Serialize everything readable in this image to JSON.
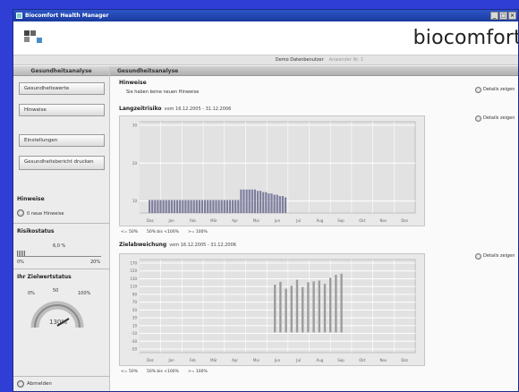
{
  "window": {
    "title": "Biocomfort Health Manager"
  },
  "brand": {
    "name": "biocomfort"
  },
  "userbar": {
    "user": "Demo Datenbenutzer",
    "secondary": "Anwender Nr. 1"
  },
  "sidebar": {
    "tab": "Gesundheitsanalyse",
    "buttons": [
      "Gesundheitswerte",
      "Hinweise",
      "Einstellungen",
      "Gesundheitsbericht drucken"
    ],
    "hinweise_heading": "Hinweise",
    "hinweise_new": "0 neue Hinweise",
    "risiko_heading": "Risikostatus",
    "risiko_value": "6,0 %",
    "risiko_min": "0%",
    "risiko_max": "20%",
    "ziel_heading": "Ihr Zielwertstatus",
    "gauge_min": "0%",
    "gauge_mid": "50",
    "gauge_max": "100%",
    "gauge_value": "130%",
    "logout": "Abmelden"
  },
  "main": {
    "tab": "Gesundheitsanalyse",
    "hinweise_title": "Hinweise",
    "hinweise_text": "Sie haben keine neuen Hinweise",
    "detail_label": "Details zeigen",
    "chart1_title": "Langzeitrisiko",
    "chart1_range": "vom 16.12.2005 - 31.12.2006",
    "chart2_title": "Zielabweichung",
    "chart2_range": "vom 16.12.2005 - 31.12.2006",
    "legend": [
      "<= 50%",
      "50% bis <100%",
      ">= 100%"
    ]
  },
  "chart_data": [
    {
      "type": "bar",
      "title": "Langzeitrisiko",
      "categories": [
        "Dez",
        "Jan",
        "Feb",
        "Mär",
        "Apr",
        "Mai",
        "Jun",
        "Jul",
        "Aug",
        "Sep",
        "Okt",
        "Nov",
        "Dez"
      ],
      "yticks": [
        "30",
        "20",
        "10"
      ],
      "ylim": [
        0,
        35
      ],
      "values": [
        5,
        5,
        5,
        5,
        5,
        5,
        5,
        5,
        5,
        5,
        5,
        5,
        5,
        5,
        5,
        5,
        5,
        5,
        5,
        5,
        5,
        5,
        5,
        5,
        5,
        5,
        5,
        5,
        5,
        5,
        5,
        5,
        5,
        9,
        9,
        9,
        9,
        9,
        9,
        8.5,
        8.5,
        8,
        8,
        7.5,
        7.5,
        7,
        7,
        6.5,
        6.5,
        6
      ],
      "colors": {
        "bar": "#7e7e9e",
        "grid": "#ffffff"
      }
    },
    {
      "type": "bar",
      "title": "Zielabweichung",
      "categories": [
        "Dez",
        "Jan",
        "Feb",
        "Mär",
        "Apr",
        "Mai",
        "Jun",
        "Jul",
        "Aug",
        "Sep",
        "Okt",
        "Nov",
        "Dez"
      ],
      "yticks": [
        "170",
        "150",
        "130",
        "110",
        "90",
        "70",
        "50",
        "30",
        "10",
        "-10",
        "-30",
        "-50"
      ],
      "ylim": [
        -50,
        180
      ],
      "values": [
        118,
        125,
        108,
        115,
        130,
        112,
        124,
        126,
        128,
        120,
        135,
        142,
        145
      ],
      "colors": {
        "bar": "#9c9c9c",
        "grid": "#ffffff"
      }
    }
  ]
}
